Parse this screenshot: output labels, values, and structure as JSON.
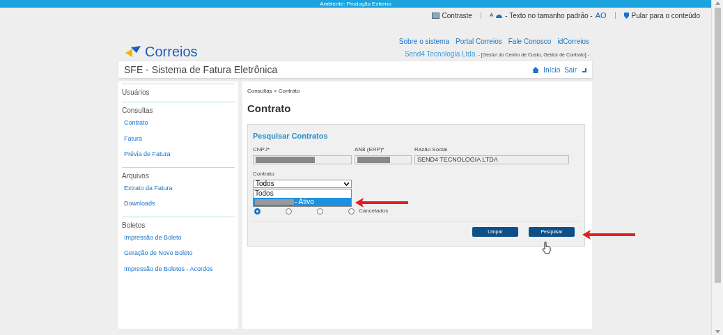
{
  "env_bar": "Ambiente: Produção Externo",
  "accessibility": {
    "contrast": "Contraste",
    "font_small": "A",
    "font_text": "- Texto no tamanho padrão -",
    "font_large": "AO",
    "skip": "Pular para o conteúdo"
  },
  "logo": "Correios",
  "top_links": [
    "Sobre o sistema",
    "Portal Correios",
    "Fale Conosco",
    "idCorreios"
  ],
  "user": {
    "company": "Send4 Tecnologia Ltda",
    "roles": "- [Gestor do Centro de Custo, Gestor de Contrato] -"
  },
  "app_title": "SFE - Sistema de Fatura Eletrônica",
  "nav": [
    {
      "label": "Início"
    },
    {
      "label": "Sair"
    }
  ],
  "sidebar": [
    {
      "label": "Usuários"
    },
    {
      "label": "Consultas",
      "children": [
        {
          "label": "Contrato"
        },
        {
          "label": "Fatura"
        },
        {
          "label": "Prévia de Fatura"
        }
      ]
    },
    {
      "label": "Arquivos",
      "children": [
        {
          "label": "Extrato da Fatura"
        },
        {
          "label": "Downloads"
        }
      ]
    },
    {
      "label": "Boletos",
      "children": [
        {
          "label": "Impressão de Boleto"
        },
        {
          "label": "Geração de Novo Boleto"
        },
        {
          "label": "Impressão de Boletos - Acordos"
        }
      ]
    }
  ],
  "breadcrumb": "Consultas > Contrato",
  "page_title": "Contrato",
  "form": {
    "title": "Pesquisar Contratos",
    "fields": [
      {
        "label": "CNPJ*",
        "redacted": true
      },
      {
        "label": "AN8 (ERP)*",
        "redacted": true
      },
      {
        "label": "Razão Social",
        "value": "SEND4 TECNOLOGIA LTDA",
        "redacted": false
      }
    ],
    "contract": {
      "label": "Contrato",
      "value": "Todos",
      "options": [
        {
          "label": "Todos",
          "highlighted": false
        },
        {
          "label": "- Ativo",
          "highlighted": true
        }
      ]
    },
    "status_radios": [
      {
        "selected": true
      },
      {
        "selected": false
      },
      {
        "selected": false
      },
      {
        "selected": false,
        "label": "Cancelados"
      }
    ],
    "buttons": [
      "Limpar",
      "Pesquisar"
    ]
  }
}
